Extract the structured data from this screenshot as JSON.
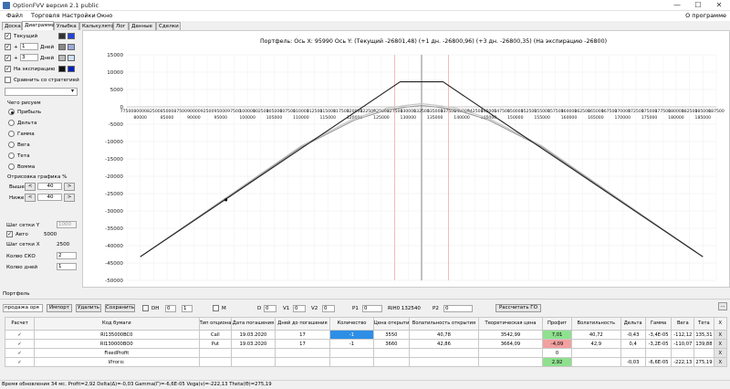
{
  "window": {
    "title": "OptionFVV версия 2.1 public",
    "min": "—",
    "max": "☐",
    "close": "✕"
  },
  "menu": {
    "items": [
      "Файл",
      "Торговля",
      "Настройки",
      "Окно"
    ],
    "about": "О программе"
  },
  "tabs": [
    "Доска",
    "Диаграмма",
    "Улыбка",
    "Калькулятор",
    "Лог",
    "Данные",
    "Сделки"
  ],
  "left": {
    "current": {
      "label": "Текущий",
      "colors": [
        "#333333",
        "#2244dd"
      ]
    },
    "plus1": {
      "sign": "+",
      "value": "1",
      "unit": "Дней",
      "colors": [
        "#888888",
        "#99aadd"
      ]
    },
    "plus2": {
      "sign": "+",
      "value": "3",
      "unit": "Дней",
      "colors": [
        "#bbbbbb",
        "#cce0ff"
      ]
    },
    "expiry": {
      "label": "На экспирацию",
      "colors": [
        "#111111",
        "#0022bb"
      ]
    },
    "compare": {
      "label": "Сравнить со стратегией"
    },
    "draw_title": "Чего рисуем",
    "radios": [
      "Прибыль",
      "Дельта",
      "Гамма",
      "Вега",
      "Тета",
      "Вомма"
    ],
    "render_title": "Отрисовка графика %",
    "above": {
      "label": "Выше",
      "value": "40",
      "dec": "<",
      "inc": ">"
    },
    "below": {
      "label": "Ниже",
      "value": "40",
      "dec": "<",
      "inc": ">"
    },
    "step_y": {
      "label": "Шаг сетки Y",
      "value": "1000"
    },
    "auto": {
      "label": "Авто",
      "value": "5000"
    },
    "step_x": {
      "label": "Шаг сетки X",
      "value": "2500"
    },
    "sko": {
      "label": "Колво СКО",
      "value": "2"
    },
    "days": {
      "label": "Колво дней",
      "value": "1"
    }
  },
  "chart_data": {
    "type": "line",
    "title": "Портфель: Ось X: 95990 Ось Y: (Текущий -26801,48) (+1 дн. -26800,96) (+3 дн. -26800,35) (На экспирацию -26800)",
    "xlim": [
      77500,
      187500
    ],
    "ylim": [
      -50000,
      15000
    ],
    "yticks": [
      15000,
      10000,
      5000,
      0,
      -5000,
      -10000,
      -15000,
      -20000,
      -25000,
      -30000,
      -35000,
      -40000,
      -45000,
      -50000
    ],
    "x_ticks_top": [
      77500,
      80000,
      82500,
      85000,
      87500,
      90000,
      92500,
      95000,
      97500,
      100000,
      102500,
      105000,
      107500,
      110000,
      112500,
      115000,
      117500,
      120000,
      122500,
      125000,
      127500,
      130000,
      132500,
      135000,
      137500,
      140000,
      142500,
      145000,
      147500,
      150000,
      152500,
      155000,
      157500,
      160000,
      162500,
      165000,
      167500,
      170000,
      172500,
      175000,
      177500,
      180000,
      182500,
      185000,
      187500
    ],
    "x_ticks_bottom": [
      80000,
      85000,
      90000,
      95000,
      100000,
      105000,
      110000,
      115000,
      120000,
      125000,
      130000,
      135000,
      140000,
      145000,
      150000,
      155000,
      160000,
      165000,
      170000,
      175000,
      180000,
      185000
    ],
    "vlines": [
      {
        "x": 132500,
        "color": "#555555"
      },
      {
        "x": 127500,
        "color": "#f2a0a0"
      },
      {
        "x": 137500,
        "color": "#f2a0a0"
      }
    ],
    "marker": {
      "x": 95990,
      "y": -26800
    },
    "series": [
      {
        "color": "#222222",
        "x": [
          80000,
          128500,
          136500,
          185000
        ],
        "y": [
          -43200,
          7200,
          7200,
          -43200
        ]
      },
      {
        "color": "#9a9a9a",
        "x": [
          80000,
          110000,
          120000,
          126000,
          130000,
          132500,
          135000,
          139000,
          145000,
          155000,
          185000
        ],
        "y": [
          -43200,
          -11600,
          -3800,
          -900,
          0,
          400,
          0,
          -900,
          -3800,
          -11600,
          -43200
        ]
      },
      {
        "color": "#c4c4c4",
        "x": [
          80000,
          110000,
          120000,
          126000,
          130000,
          132500,
          135000,
          139000,
          145000,
          155000,
          185000
        ],
        "y": [
          -43200,
          -11300,
          -3300,
          -400,
          500,
          900,
          500,
          -400,
          -3300,
          -11300,
          -43200
        ]
      }
    ]
  },
  "portfolio": {
    "label": "Портфель",
    "mode": "продажа оря",
    "import": "Импорт",
    "delete": "Удалить",
    "save": "Сохранить",
    "dh": "DH",
    "dh_v1": "0",
    "dh_v2": "1",
    "m": "M",
    "d_label": "D",
    "d": "0",
    "v1_label": "V1",
    "v1": "0",
    "v2_label": "V2",
    "v2": "0",
    "p1_label": "P1",
    "p1": "0",
    "ri_label": "RIH0 132540",
    "p2_label": "P2",
    "p2": "0",
    "calc": "Рассчитать ГО",
    "more": "..."
  },
  "table": {
    "headers": [
      "Расчет",
      "Код бумаги",
      "Тип опциона",
      "Дата погашения",
      "Дней до погашения",
      "Количество",
      "Цена открытия",
      "Волатильность открытия",
      "Теоретическая цена",
      "Профит",
      "Волатильность",
      "Дельта",
      "Гамма",
      "Вега",
      "Тета",
      "X"
    ],
    "rows": [
      {
        "checked": "✓",
        "code": "RI135000BC0",
        "type": "Call",
        "date": "19.03.2020",
        "days": "17",
        "qty": "-1",
        "price": "3550",
        "vol_open": "40,78",
        "theor": "3542,99",
        "profit": "7,01",
        "vol": "40,72",
        "delta": "-0,43",
        "gamma": "-3,4E-05",
        "vega": "-112,12",
        "theta": "135,31",
        "x": "X"
      },
      {
        "checked": "✓",
        "code": "RI130000BO0",
        "type": "Put",
        "date": "19.03.2020",
        "days": "17",
        "qty": "-1",
        "price": "3660",
        "vol_open": "42,86",
        "theor": "3664,09",
        "profit": "-4,09",
        "vol": "42,9",
        "delta": "0,4",
        "gamma": "-3,2E-05",
        "vega": "-110,07",
        "theta": "139,88",
        "x": "X"
      },
      {
        "checked": "✓",
        "code": "FixedProfit",
        "type": "",
        "date": "",
        "days": "",
        "qty": "",
        "price": "",
        "vol_open": "",
        "theor": "",
        "profit": "0",
        "vol": "",
        "delta": "",
        "gamma": "",
        "vega": "",
        "theta": "",
        "x": "X"
      },
      {
        "checked": "✓",
        "code": "Итого:",
        "type": "",
        "date": "",
        "days": "",
        "qty": "",
        "price": "",
        "vol_open": "",
        "theor": "",
        "profit": "2,92",
        "vol": "",
        "delta": "-0,03",
        "gamma": "-6,6E-05",
        "vega": "-222,13",
        "theta": "275,19",
        "x": "X"
      }
    ]
  },
  "status": "Время обновления 34 мс. Profit=2,92 Delta(Δ)=-0,03 Gamma(Γ)=-6,6E-05 Vega(ν)=-222,13 Theta(Θ)=275,19"
}
